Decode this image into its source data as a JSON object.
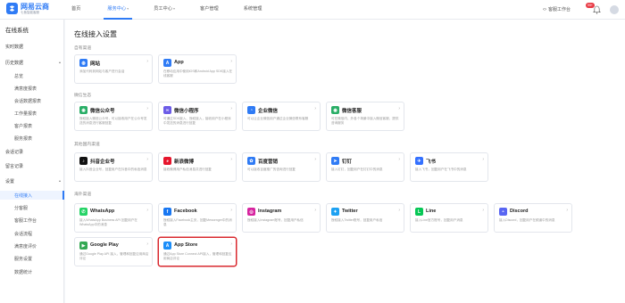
{
  "app": {
    "name": "网易云商",
    "subtitle": "七鱼智能客服"
  },
  "nav": [
    {
      "label": "首页",
      "active": false,
      "caret": false
    },
    {
      "label": "服务中心",
      "active": true,
      "caret": true
    },
    {
      "label": "员工中心",
      "active": false,
      "caret": true
    },
    {
      "label": "客户管理",
      "active": false,
      "caret": false
    },
    {
      "label": "系统管理",
      "active": false,
      "caret": false
    }
  ],
  "header": {
    "workbench": "客服工作台",
    "badge": "99+"
  },
  "sidebar": {
    "title": "在线系统",
    "items": [
      {
        "label": "实时数据",
        "type": "item"
      },
      {
        "label": "历史数据",
        "type": "group"
      },
      {
        "label": "总览",
        "type": "sub"
      },
      {
        "label": "满意度报表",
        "type": "sub"
      },
      {
        "label": "会话数据报表",
        "type": "sub"
      },
      {
        "label": "工作量报表",
        "type": "sub"
      },
      {
        "label": "客户报表",
        "type": "sub"
      },
      {
        "label": "服务报表",
        "type": "sub"
      },
      {
        "label": "会话记录",
        "type": "item"
      },
      {
        "label": "留言记录",
        "type": "item"
      },
      {
        "label": "设置",
        "type": "group"
      },
      {
        "label": "在线接入",
        "type": "sub",
        "active": true
      },
      {
        "label": "分客服",
        "type": "sub"
      },
      {
        "label": "客服工作台",
        "type": "sub"
      },
      {
        "label": "会话流程",
        "type": "sub"
      },
      {
        "label": "满意度评价",
        "type": "sub"
      },
      {
        "label": "服务设置",
        "type": "sub"
      },
      {
        "label": "数据统计",
        "type": "sub"
      }
    ]
  },
  "main": {
    "title": "在线接入设置",
    "sections": [
      {
        "label": "自有渠道",
        "cards": [
          {
            "name": "网站",
            "desc": "添加代码到网站与客户进行会话",
            "icon": "globe-icon",
            "color": "#2f7bf5"
          },
          {
            "name": "App",
            "desc": "在移动应用中使用iOS和Android App SDK接入在线客服",
            "icon": "app-icon",
            "color": "#2f7bf5"
          }
        ]
      },
      {
        "label": "微信生态",
        "cards": [
          {
            "name": "微信公众号",
            "desc": "授权接入微信公众号，可以接收用户在公众号发送的消息进行客服回复",
            "icon": "wechat-official-icon",
            "color": "#2aae67"
          },
          {
            "name": "微信小程序",
            "desc": "可通过SDK嵌入、授权接入，接收用户在小程序中发送的消息进行回复",
            "icon": "miniprogram-icon",
            "color": "#6c5ce7"
          },
          {
            "name": "企业微信",
            "desc": "可以让企业微信用户通过企业微信联系客服",
            "icon": "wecom-icon",
            "color": "#2f7bf5"
          },
          {
            "name": "微信客服",
            "desc": "可在微信内、外各个场景中接入微信客服，提供咨询服务",
            "icon": "wechat-kf-icon",
            "color": "#2aae67"
          }
        ]
      },
      {
        "label": "其他国内渠道",
        "cards": [
          {
            "name": "抖音企业号",
            "desc": "接入抖音企业号，回复用户在抖音中的私信消息",
            "icon": "douyin-icon",
            "color": "#111111"
          },
          {
            "name": "新浪微博",
            "desc": "接收微博用户私信消息并进行回复",
            "icon": "weibo-icon",
            "color": "#e6162d"
          },
          {
            "name": "百度营销",
            "desc": "可以接收百度推广的咨询进行回复",
            "icon": "baidu-icon",
            "color": "#2f7bf5"
          },
          {
            "name": "钉钉",
            "desc": "接入钉钉，回复用户在钉钉中的消息",
            "icon": "dingtalk-icon",
            "color": "#2f7bf5"
          },
          {
            "name": "飞书",
            "desc": "接入飞书，回复用户在飞书中的消息",
            "icon": "feishu-icon",
            "color": "#3370ff"
          }
        ]
      },
      {
        "label": "海外渠道",
        "cards": [
          {
            "name": "WhatsApp",
            "desc": "接入WhatsApp Business API 回复用户在WhatsApp中的消息",
            "icon": "whatsapp-icon",
            "color": "#25d366"
          },
          {
            "name": "Facebook",
            "desc": "授权接入Facebook主页，回复Messenger中的消息",
            "icon": "facebook-icon",
            "color": "#1877f2"
          },
          {
            "name": "Instagram",
            "desc": "授权接入Instagram账号，回复用户私信",
            "icon": "instagram-icon",
            "color": "#d6249f"
          },
          {
            "name": "Twitter",
            "desc": "授权接入Twitter账号，回复用户私信",
            "icon": "twitter-icon",
            "color": "#1da1f2"
          },
          {
            "name": "Line",
            "desc": "接入Line官方账号，回复用户消息",
            "icon": "line-icon",
            "color": "#06c755"
          },
          {
            "name": "Discord",
            "desc": "接入Discord，回复用户在频道中的消息",
            "icon": "discord-icon",
            "color": "#5865f2"
          },
          {
            "name": "Google Play",
            "desc": "通过Google Play API 接入，管理和回复应用商店评论",
            "icon": "google-play-icon",
            "color": "#34a853"
          },
          {
            "name": "App Store",
            "desc": "通过App Store Connect API接入，管理和回复应用商店评论",
            "icon": "app-store-icon",
            "color": "#1c8ef9",
            "highlight": true
          }
        ]
      }
    ]
  }
}
